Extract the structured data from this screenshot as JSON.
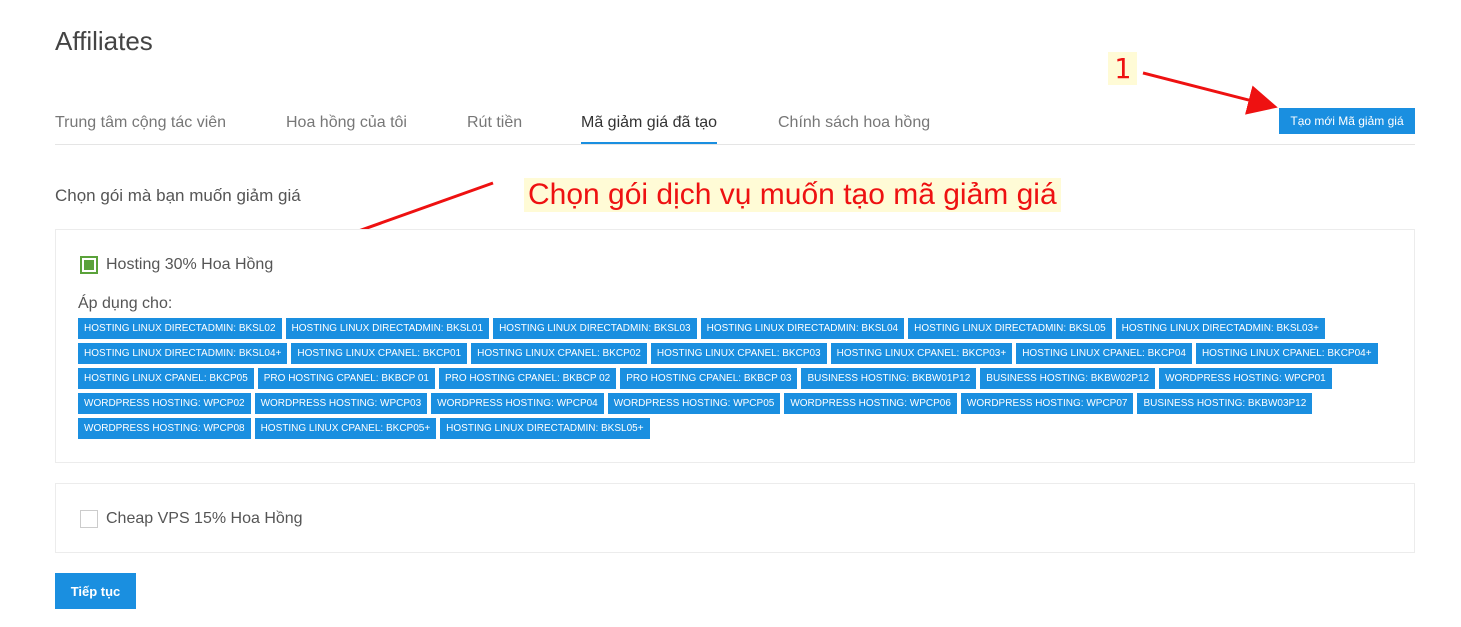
{
  "page": {
    "title": "Affiliates"
  },
  "tabs": [
    {
      "label": "Trung tâm cộng tác viên",
      "active": false
    },
    {
      "label": "Hoa hồng của tôi",
      "active": false
    },
    {
      "label": "Rút tiền",
      "active": false
    },
    {
      "label": "Mã giảm giá đã tạo",
      "active": true
    },
    {
      "label": "Chính sách hoa hồng",
      "active": false
    }
  ],
  "toolbar": {
    "create_label": "Tạo mới Mã giảm giá"
  },
  "annotations": {
    "step_number": "1",
    "instruction": "Chọn gói dịch vụ muốn tạo mã giảm giá",
    "color": "#ee1111",
    "highlight": "#fffbd6"
  },
  "section": {
    "label": "Chọn gói mà bạn muốn giảm giá"
  },
  "packages": [
    {
      "name": "Hosting 30% Hoa Hồng",
      "checked": true,
      "apply_label": "Áp dụng cho:",
      "chips": [
        "HOSTING LINUX DIRECTADMIN: BKSL02",
        "HOSTING LINUX DIRECTADMIN: BKSL01",
        "HOSTING LINUX DIRECTADMIN: BKSL03",
        "HOSTING LINUX DIRECTADMIN: BKSL04",
        "HOSTING LINUX DIRECTADMIN: BKSL05",
        "HOSTING LINUX DIRECTADMIN: BKSL03+",
        "HOSTING LINUX DIRECTADMIN: BKSL04+",
        "HOSTING LINUX CPANEL: BKCP01",
        "HOSTING LINUX CPANEL: BKCP02",
        "HOSTING LINUX CPANEL: BKCP03",
        "HOSTING LINUX CPANEL: BKCP03+",
        "HOSTING LINUX CPANEL: BKCP04",
        "HOSTING LINUX CPANEL: BKCP04+",
        "HOSTING LINUX CPANEL: BKCP05",
        "PRO HOSTING CPANEL: BKBCP 01",
        "PRO HOSTING CPANEL: BKBCP 02",
        "PRO HOSTING CPANEL: BKBCP 03",
        "BUSINESS HOSTING: BKBW01P12",
        "BUSINESS HOSTING: BKBW02P12",
        "WORDPRESS HOSTING: WPCP01",
        "WORDPRESS HOSTING: WPCP02",
        "WORDPRESS HOSTING: WPCP03",
        "WORDPRESS HOSTING: WPCP04",
        "WORDPRESS HOSTING: WPCP05",
        "WORDPRESS HOSTING: WPCP06",
        "WORDPRESS HOSTING: WPCP07",
        "BUSINESS HOSTING: BKBW03P12",
        "WORDPRESS HOSTING: WPCP08",
        "HOSTING LINUX CPANEL: BKCP05+",
        "HOSTING LINUX DIRECTADMIN: BKSL05+"
      ]
    },
    {
      "name": "Cheap VPS 15% Hoa Hồng",
      "checked": false
    }
  ],
  "footer": {
    "next_label": "Tiếp tục"
  },
  "colors": {
    "accent": "#1a8fe0",
    "check": "#5aa23a"
  }
}
